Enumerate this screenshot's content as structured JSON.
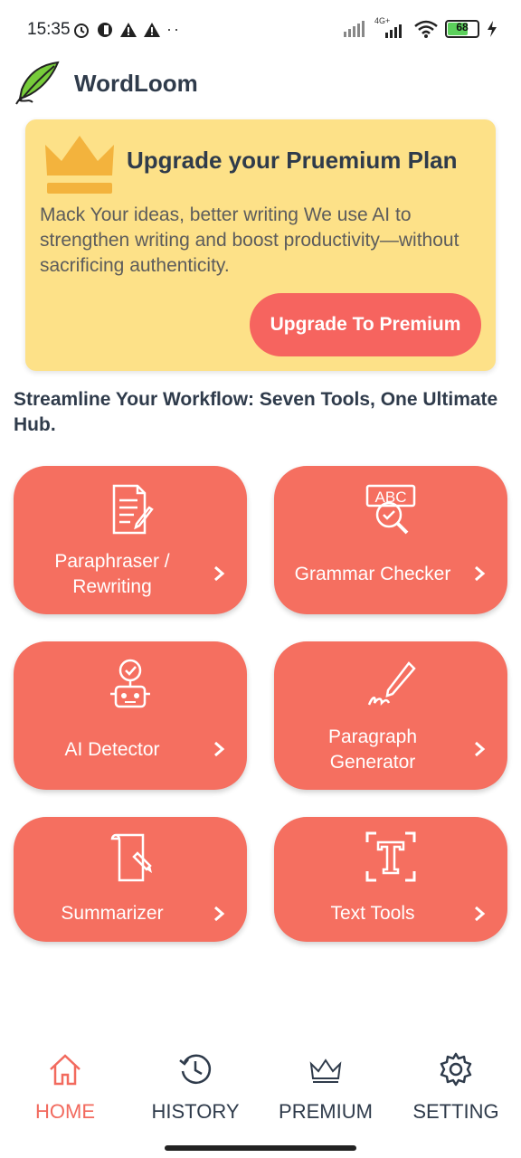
{
  "status_bar": {
    "time": "15:35",
    "battery": "68",
    "network": "4G+"
  },
  "app": {
    "title": "WordLoom"
  },
  "premium": {
    "title": "Upgrade your Pruemium Plan",
    "description": "Mack Your ideas, better writing We use AI to strengthen writing and boost productivity—without sacrificing authenticity.",
    "button_label": "Upgrade To Premium"
  },
  "section": {
    "heading": "Streamline Your Workflow: Seven Tools, One Ultimate Hub."
  },
  "tools": [
    {
      "label_line1": "Paraphraser /",
      "label_line2": "Rewriting",
      "icon": "document-pen-icon"
    },
    {
      "label_line1": "Grammar Checker",
      "label_line2": "",
      "icon": "abc-magnifier-icon"
    },
    {
      "label_line1": "AI Detector",
      "label_line2": "",
      "icon": "robot-icon"
    },
    {
      "label_line1": "Paragraph",
      "label_line2": "Generator",
      "icon": "pen-signature-icon"
    },
    {
      "label_line1": "Summarizer",
      "label_line2": "",
      "icon": "scroll-pen-icon"
    },
    {
      "label_line1": "Text Tools",
      "label_line2": "",
      "icon": "text-frame-icon"
    }
  ],
  "nav": {
    "items": [
      {
        "label": "HOME",
        "icon": "home-icon",
        "active": true
      },
      {
        "label": "HISTORY",
        "icon": "history-icon",
        "active": false
      },
      {
        "label": "PREMIUM",
        "icon": "crown-icon",
        "active": false
      },
      {
        "label": "SETTING",
        "icon": "gear-icon",
        "active": false
      }
    ]
  },
  "colors": {
    "accent": "#f56f60",
    "card": "#fde188",
    "text": "#2f3b4b"
  }
}
